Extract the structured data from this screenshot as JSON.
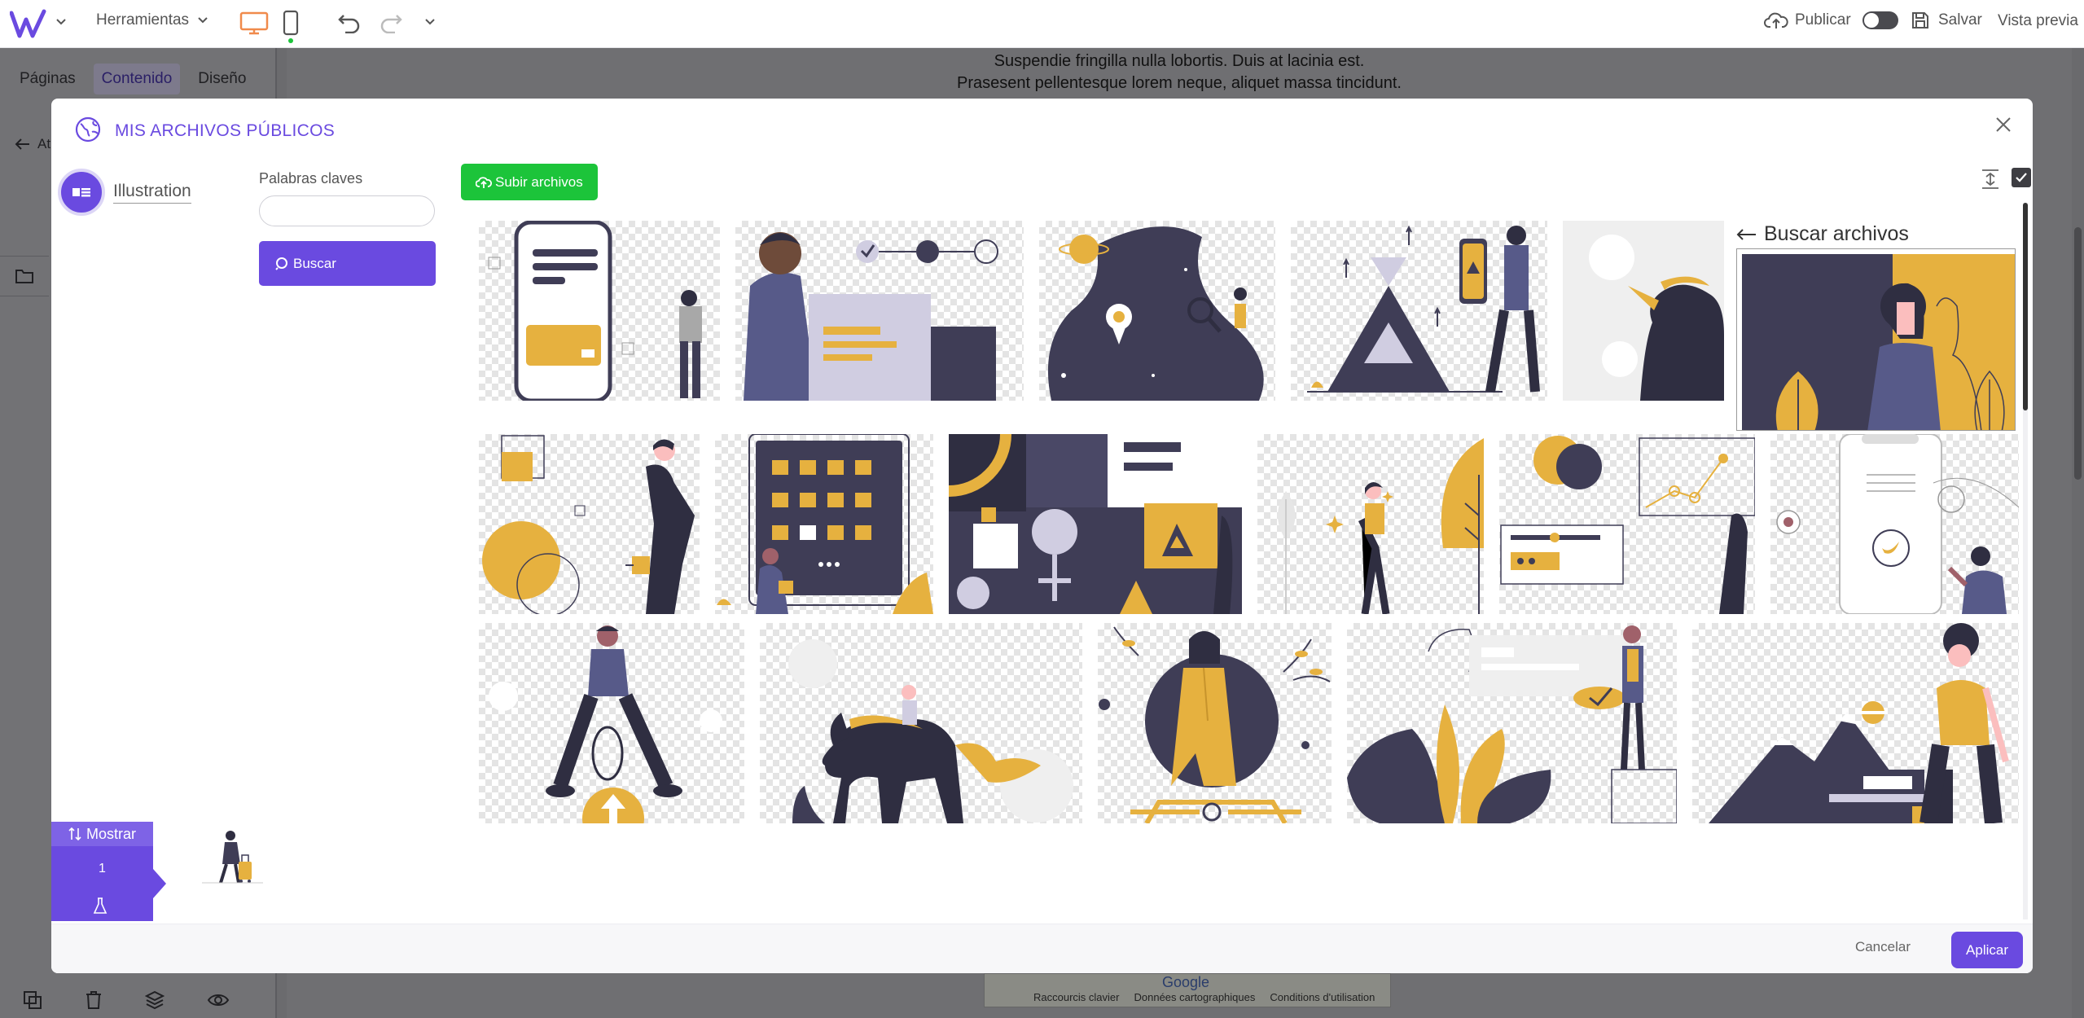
{
  "topbar": {
    "tools_label": "Herramientas",
    "publish_label": "Publicar",
    "save_label": "Salvar",
    "preview_label": "Vista previa",
    "accent_device": "#f08a4b"
  },
  "left_panel": {
    "tabs": [
      "Páginas",
      "Contenido",
      "Diseño"
    ],
    "active_tab": "Contenido",
    "back_label": "At"
  },
  "background_text": [
    "Suspendie fringilla nulla lobortis. Duis at lacinia est.",
    "Prasesent pellentesque lorem neque, aliquet massa tincidunt."
  ],
  "map_strip": {
    "google": "Google",
    "links": [
      "Raccourcis clavier",
      "Données cartographiques",
      "Conditions d'utilisation"
    ]
  },
  "modal": {
    "title": "MIS ARCHIVOS PÚBLICOS",
    "category_label": "Illustration",
    "keywords_label": "Palabras claves",
    "keywords_value": "",
    "search_button": "Buscar",
    "upload_button": "Subir archivos",
    "detail_title": "Buscar archivos",
    "tray": {
      "toggle_label": "Mostrar",
      "count": "1"
    },
    "cancel_button": "Cancelar",
    "apply_button": "Aplicar"
  },
  "colors": {
    "primary": "#6a4ae0",
    "upload": "#1cc43a",
    "illustration_dark": "#3f3d56",
    "illustration_yellow": "#e6b13f"
  }
}
